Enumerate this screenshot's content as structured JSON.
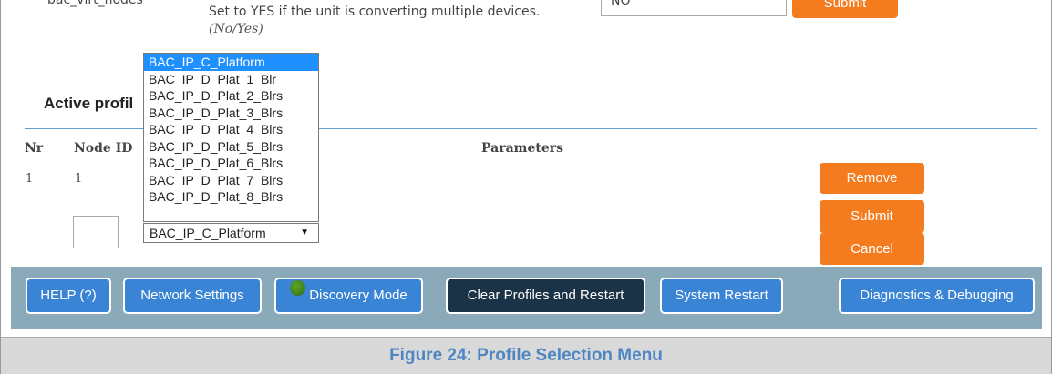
{
  "top_row": {
    "cut_label": "bac_virt_nodes",
    "description": "Set to YES if the unit is converting multiple devices.",
    "hint": "(No/Yes)",
    "input_value": "NO",
    "submit_label": "Submit"
  },
  "section_title": "Active profil",
  "table": {
    "headers": {
      "nr": "Nr",
      "node_id": "Node ID",
      "parameters": "Parameters"
    },
    "row": {
      "nr": "1",
      "node_id": "1"
    }
  },
  "dropdown": {
    "options": [
      "BAC_IP_C_Platform",
      "BAC_IP_D_Plat_1_Blr",
      "BAC_IP_D_Plat_2_Blrs",
      "BAC_IP_D_Plat_3_Blrs",
      "BAC_IP_D_Plat_4_Blrs",
      "BAC_IP_D_Plat_5_Blrs",
      "BAC_IP_D_Plat_6_Blrs",
      "BAC_IP_D_Plat_7_Blrs",
      "BAC_IP_D_Plat_8_Blrs"
    ],
    "selected": "BAC_IP_C_Platform",
    "arrow_icon": "caret-down-icon"
  },
  "actions": {
    "remove_label": "Remove",
    "submit_label": "Submit",
    "cancel_label": "Cancel"
  },
  "toolbar": {
    "help": "HELP (?)",
    "network": "Network Settings",
    "discovery": "Discovery Mode",
    "clear": "Clear Profiles and Restart",
    "restart": "System Restart",
    "diagnostics": "Diagnostics & Debugging"
  },
  "caption": "Figure 24: Profile Selection Menu",
  "colors": {
    "accent_orange": "#f57b1f",
    "button_blue": "#3a84d6",
    "toolbar_bg": "#8aaab9",
    "dark_button": "#1b3346",
    "caption_blue": "#4e86c3",
    "selection_blue": "#1e90ff"
  }
}
